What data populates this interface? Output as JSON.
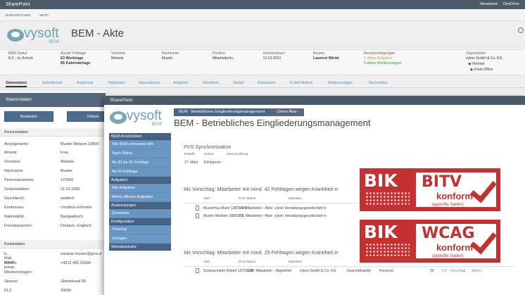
{
  "app": {
    "title": "SharePoint",
    "top_links": [
      "Newsfeed",
      "OneDrive"
    ],
    "sub_links": [
      "DURCHSUCHEN",
      "SEITE"
    ],
    "logo_text": "vysoft",
    "logo_sub": "BEM",
    "page_title": "BEM - Akte"
  },
  "summary": {
    "bem_status_label": "BEM Status",
    "bem_status": "0.2 - In Arbeit",
    "fehltage_label": "Anzahl Fehltage",
    "werktage": "63 Werktage",
    "kalendertage": "85 Kalendertage",
    "vorname_label": "Vorname",
    "vorname": "Melanie",
    "nachname_label": "Nachname",
    "nachname": "Muster",
    "position_label": "Position",
    "position": "Mitarbeiter/in,",
    "eintritt_label": "Eintrittsdatum",
    "eintritt": "01.01.2010",
    "berater_label": "Berater",
    "berater": "Laurent Wicht",
    "benach_label": "Benachrichtigungen",
    "benach1": "1 offene Aufgaben",
    "benach2": "0 aktive Wiedervorlagen",
    "org_label": "Organisation",
    "org": "vykon GmbH & Co. KG",
    "org_items": [
      "Vertrieb",
      "Front-Office"
    ]
  },
  "tabs": [
    "Stammdaten",
    "Kalenderium",
    "Anamnese",
    "Tätigkeiten",
    "Massnahmen",
    "Aufgaben",
    "Workflows",
    "Verlauf",
    "Dokumente",
    "E-Mail Historie",
    "Wiedervorlagen",
    "Nachrichten"
  ],
  "left": {
    "header": "Stammdaten",
    "buttons": [
      "Bearbeiten",
      "Historie"
    ],
    "personal_header": "Personendaten",
    "fields": [
      {
        "k": "Anzeigename:",
        "v": "Muster Melanie 19800"
      },
      {
        "k": "Anrede:",
        "v": "Frau"
      },
      {
        "k": "Vorname:",
        "v": "Melanie"
      },
      {
        "k": "Nachname:",
        "v": "Muster"
      },
      {
        "k": "Personalnummer:",
        "v": "123456"
      },
      {
        "k": "Geburtsdatum:",
        "v": "01.01.1980"
      },
      {
        "k": "Geschlecht:",
        "v": "weiblich"
      },
      {
        "k": "Konfession:",
        "v": "christlich-orthodox"
      },
      {
        "k": "Nationalität:",
        "v": "Bangladesch"
      },
      {
        "k": "Fremdsprachen:",
        "v": "Deutsch, Englisch"
      }
    ],
    "contact_header": "Kontaktdaten",
    "contact": [
      {
        "k": "E-Mail privat:",
        "v": "melanie.muster@gmx.d"
      },
      {
        "k": "Telefon privat:",
        "v": "+4912 455 20099"
      },
      {
        "k": "Wiedervorlagen:",
        "v": ""
      },
      {
        "k": "Strasse:",
        "v": "Steintorwall 99"
      },
      {
        "k": "PLZ:",
        "v": "20095"
      }
    ]
  },
  "window": {
    "title": "SharePoint",
    "crumb_active": "BEM - Betriebliches Eingliederungsmanagement",
    "crumb_current": "- Demo Akte -",
    "logo_text": "vysoft",
    "logo_sub": "BEM",
    "page_title": "BEM - Betriebliches Eingliederungsmanagement",
    "nav": [
      {
        "group": "BEM Anschreiben",
        "items": [
          "Alle BEM-relevanten MA",
          "Nach Status",
          "Ab 30 bis 41 Fehltage",
          "Ab 42 Fehltage"
        ]
      },
      {
        "group": "Aufgaben",
        "items": [
          "Alle Aufgaben",
          "Meine offenen Aufgaben"
        ]
      },
      {
        "group": "Auswertungen",
        "items": [
          "Quickview"
        ]
      },
      {
        "group": "Konfiguration",
        "items": [
          "Timerlog",
          "Vorlagen"
        ]
      },
      {
        "group": "Websiteinhalte",
        "items": []
      }
    ],
    "sync_title": "PVS Synchronisation",
    "sync_cols": [
      "Erstellt",
      "Status",
      "Beschreibung"
    ],
    "sync_row": [
      "27. März",
      "Erfolgreich",
      ""
    ],
    "sec1_title": "Als Vorschlag: Mitarbeiter mit mind. 42 Fehltagen wegen Krankheit in",
    "cols": [
      "Titel",
      "PVS Status",
      "Mandant"
    ],
    "rows1": [
      [
        "Musterfrau Marie 19870409",
        "2.1: Mitarbeiter - Aktiv",
        "vykon Verwaltungsgesellschaft m"
      ],
      [
        "Muster Melanie 19800101",
        "2.1: Mitarbeiter - Aktiv",
        "vykon Verwaltungsgesellschaft m"
      ]
    ],
    "sec2_title": "Als Vorschlag: Mitarbeiter mit mind. 25 Fehltagen wegen Krankheit in",
    "rows2": [
      [
        "Scheuermann Robert 19750102",
        "2.98: Mitarbeiter - Abgelehnt",
        "vykon GmbH & Co. KG",
        "Geschäftsstelle",
        "Personal",
        "26",
        "0.0 - Vorschlag",
        "Aktion"
      ]
    ]
  },
  "badges": [
    {
      "left": "BIK",
      "word": "BITV",
      "konf": "konform",
      "sub": "(geprüfte Seiten)"
    },
    {
      "left": "BIK",
      "word": "WCAG",
      "konf": "konform",
      "sub": "(geprüfte Seiten)"
    }
  ],
  "colors": {
    "accent": "#4b5b68",
    "brand": "#6f9db1",
    "badge": "#c53031",
    "nav": "#6a96c4"
  }
}
